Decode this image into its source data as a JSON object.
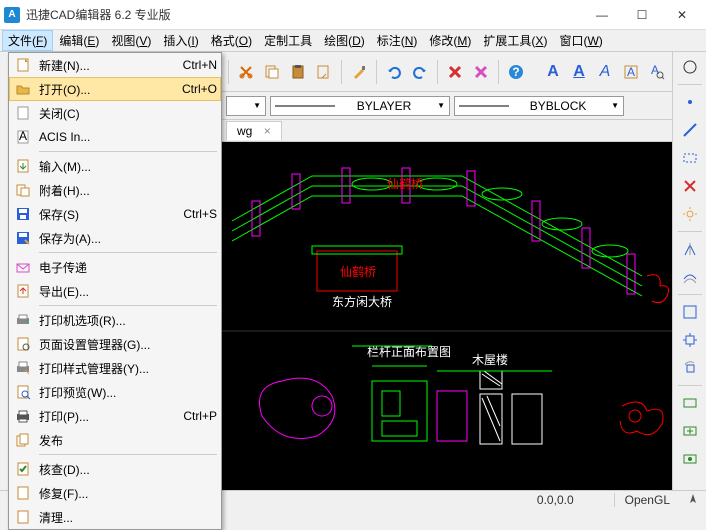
{
  "title": "迅捷CAD编辑器 6.2 专业版",
  "winControls": {
    "min": "—",
    "max": "☐",
    "close": "✕"
  },
  "menubar": [
    {
      "label": "文件",
      "key": "F",
      "active": true
    },
    {
      "label": "编辑",
      "key": "E"
    },
    {
      "label": "视图",
      "key": "V"
    },
    {
      "label": "插入",
      "key": "I"
    },
    {
      "label": "格式",
      "key": "O"
    },
    {
      "label": "定制工具"
    },
    {
      "label": "绘图",
      "key": "D"
    },
    {
      "label": "标注",
      "key": "N"
    },
    {
      "label": "修改",
      "key": "M"
    },
    {
      "label": "扩展工具",
      "key": "X"
    },
    {
      "label": "窗口",
      "key": "W"
    }
  ],
  "fileMenu": [
    {
      "icon": "new",
      "label": "新建(N)...",
      "shortcut": "Ctrl+N"
    },
    {
      "icon": "open",
      "label": "打开(O)...",
      "shortcut": "Ctrl+O",
      "hover": true
    },
    {
      "icon": "close",
      "label": "关闭(C)"
    },
    {
      "icon": "acis",
      "label": "ACIS In..."
    },
    {
      "sep": true
    },
    {
      "icon": "import",
      "label": "输入(M)..."
    },
    {
      "icon": "attach",
      "label": "附着(H)..."
    },
    {
      "icon": "save",
      "label": "保存(S)",
      "shortcut": "Ctrl+S"
    },
    {
      "icon": "saveas",
      "label": "保存为(A)..."
    },
    {
      "sep": true
    },
    {
      "icon": "etransmit",
      "label": "电子传递"
    },
    {
      "icon": "export",
      "label": "导出(E)..."
    },
    {
      "sep": true
    },
    {
      "icon": "printopt",
      "label": "打印机选项(R)..."
    },
    {
      "icon": "pagesetup",
      "label": "页面设置管理器(G)..."
    },
    {
      "icon": "printstyle",
      "label": "打印样式管理器(Y)..."
    },
    {
      "icon": "printpreview",
      "label": "打印预览(W)..."
    },
    {
      "icon": "print",
      "label": "打印(P)...",
      "shortcut": "Ctrl+P"
    },
    {
      "icon": "publish",
      "label": "发布"
    },
    {
      "sep": true
    },
    {
      "icon": "audit",
      "label": "核查(D)..."
    },
    {
      "icon": "recover",
      "label": "修复(F)..."
    },
    {
      "icon": "purge",
      "label": "清理..."
    }
  ],
  "propbar": {
    "layer": "",
    "linetype": "BYLAYER",
    "lineweight": "BYBLOCK"
  },
  "tabbar": {
    "tab1": "wg",
    "close": "×"
  },
  "toolbarRight": {
    "A1": "A",
    "A2": "A",
    "A3": "A"
  },
  "canvas": {
    "label_top": "仙鹤桥",
    "label_mid": "仙鹤桥",
    "label_sub": "东方闲大桥",
    "label_plan": "栏杆正面布置图",
    "label_house": "木屋楼"
  },
  "status": {
    "coords": "0.0,0.0",
    "renderer": "OpenGL"
  }
}
